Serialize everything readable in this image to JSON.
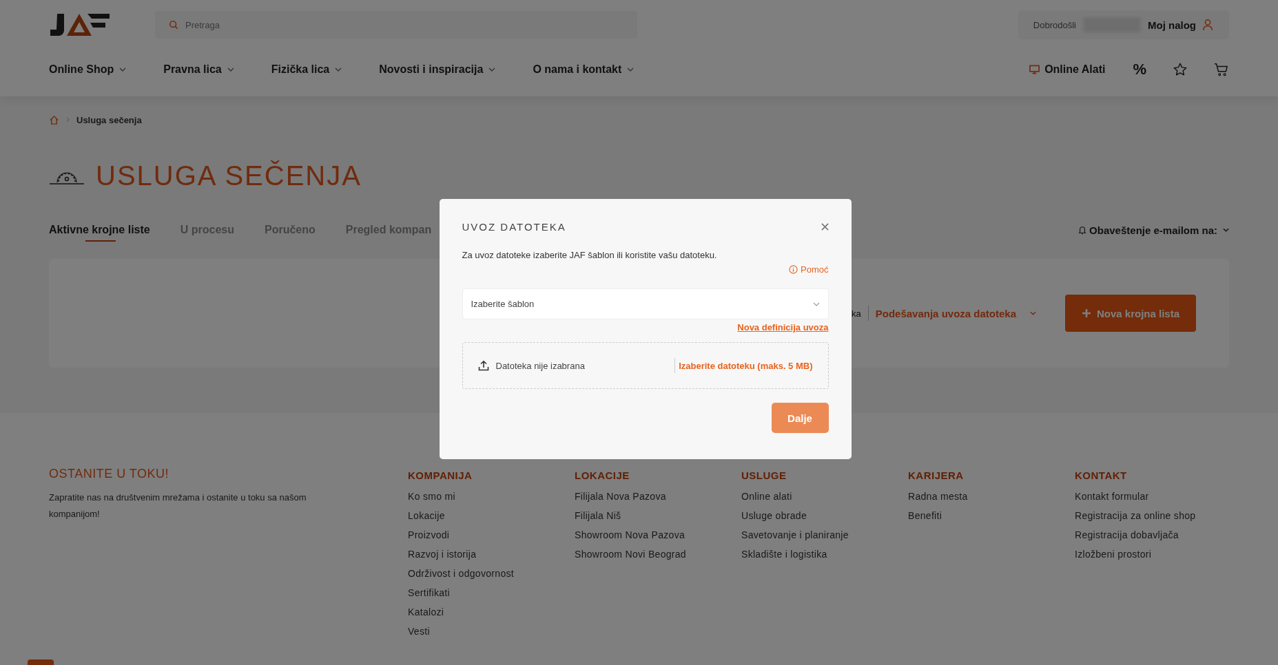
{
  "header": {
    "search": {
      "placeholder": "Pretraga"
    },
    "welcome": "Dobrodošli",
    "account": "Moj nalog",
    "nav": [
      "Online Shop",
      "Pravna lica",
      "Fizička lica",
      "Novosti i inspiracija",
      "O nama i kontakt"
    ],
    "online_tools": "Online Alati",
    "discount": "%"
  },
  "breadcrumb": {
    "current": "Usluga sečenja"
  },
  "page_title": "USLUGA SEČENJA",
  "tabs": [
    {
      "label": "Aktivne krojne liste",
      "selected": true
    },
    {
      "label": "U procesu",
      "selected": false
    },
    {
      "label": "Poručeno",
      "selected": false
    },
    {
      "label": "Pregled kompan",
      "selected": false
    }
  ],
  "notify": "Obaveštenje e-mailom na:",
  "toolbar": {
    "cut_text": "ka",
    "import_settings": "Podešavanja uvoza datoteka",
    "new_button": "Nova krojna lista"
  },
  "modal": {
    "title": "UVOZ DATOTEKA",
    "description": "Za uvoz datoteke izaberite JAF šablon ili koristite vašu datoteku.",
    "help": "Pomoć",
    "select_placeholder": "Izaberite šablon",
    "new_definition": "Nova definicija uvoza",
    "file_status": "Datoteka nije izabrana",
    "choose_file": "Izaberite datoteku (maks. 5 MB)",
    "next_button": "Dalje"
  },
  "footer": {
    "newsletter_title": "OSTANITE U TOKU!",
    "newsletter_text": "Zapratite nas na društvenim mrežama i ostanite u toku sa našom kompanijom!",
    "columns": [
      {
        "title": "KOMPANIJA",
        "links": [
          "Ko smo mi",
          "Lokacije",
          "Proizvodi",
          "Razvoj i istorija",
          "Održivost i odgovornost",
          "Sertifikati",
          "Katalozi",
          "Vesti"
        ]
      },
      {
        "title": "LOKACIJE",
        "links": [
          "Filijala Nova Pazova",
          "Filijala Niš",
          "Showroom Nova Pazova",
          "Showroom Novi Beograd"
        ]
      },
      {
        "title": "USLUGE",
        "links": [
          "Online alati",
          "Usluge obrade",
          "Savetovanje i planiranje",
          "Skladište i logistika"
        ]
      },
      {
        "title": "KARIJERA",
        "links": [
          "Radna mesta",
          "Benefiti"
        ]
      },
      {
        "title": "KONTAKT",
        "links": [
          "Kontakt formular",
          "Registracija za online shop",
          "Registracija dobavljača",
          "Izložbeni prostori"
        ]
      }
    ]
  }
}
